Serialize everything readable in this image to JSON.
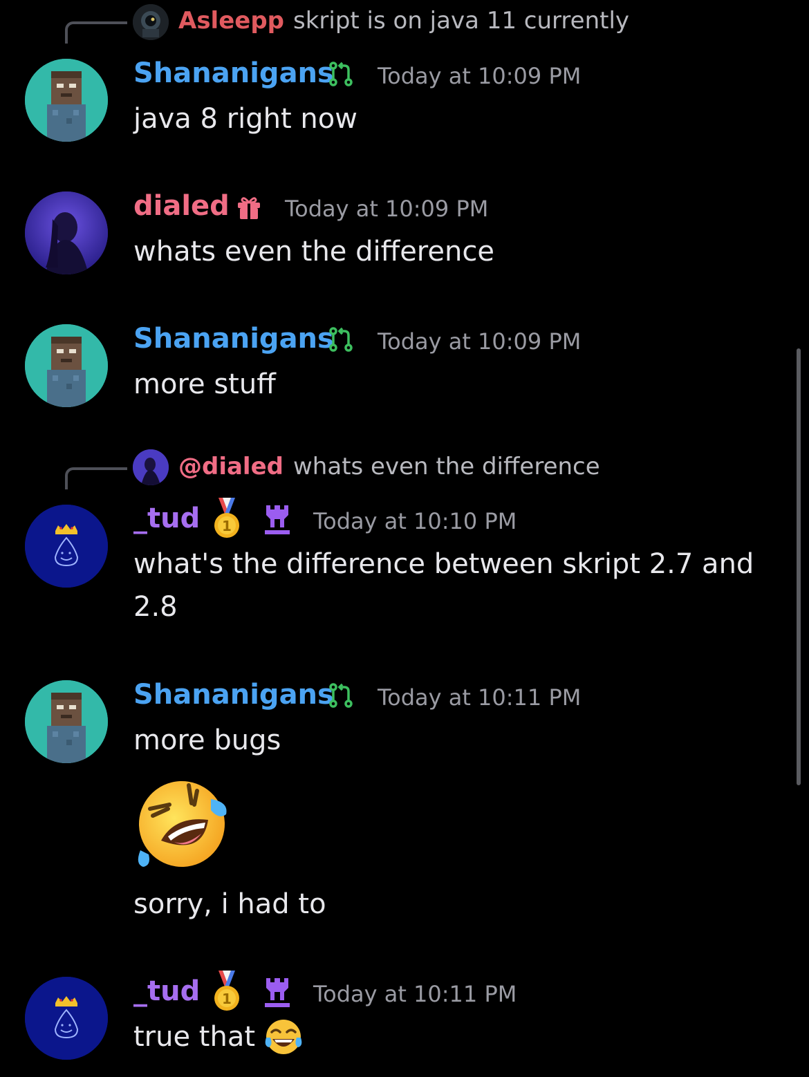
{
  "colors": {
    "shananigans_name": "#4ba3f2",
    "dialed_name": "#f06d85",
    "asleepp_name": "#e05a5f",
    "tud_name": "#a66ef0",
    "mention": "#f06d85",
    "timestamp": "#9a9ba3",
    "background": "#000000"
  },
  "reply1": {
    "author": "Asleepp",
    "text": "skript is on java 11 currently"
  },
  "msg1": {
    "author": "Shananigans",
    "timestamp": "Today at 10:09 PM",
    "text": "java 8 right now",
    "badge_icon": "pull-request-icon"
  },
  "msg2": {
    "author": "dialed",
    "timestamp": "Today at 10:09 PM",
    "text": "whats even the difference",
    "badge_icon": "gift-icon"
  },
  "msg3": {
    "author": "Shananigans",
    "timestamp": "Today at 10:09 PM",
    "text": "more stuff"
  },
  "reply2": {
    "author": "@dialed",
    "text": "whats even the difference"
  },
  "msg4": {
    "author": "_tud",
    "timestamp": "Today at 10:10 PM",
    "text": "what's the difference between skript 2.7 and 2.8",
    "badges": [
      "first-place-medal-icon",
      "castle-tower-icon"
    ]
  },
  "msg5": {
    "author": "Shananigans",
    "timestamp": "Today at 10:11 PM",
    "text": "more bugs",
    "emoji": "rolling-on-floor-laughing-emoji",
    "followup": "sorry, i had to"
  },
  "msg6": {
    "author": "_tud",
    "timestamp": "Today at 10:11 PM",
    "text": "true that",
    "emoji": "face-with-tears-of-joy-emoji"
  }
}
